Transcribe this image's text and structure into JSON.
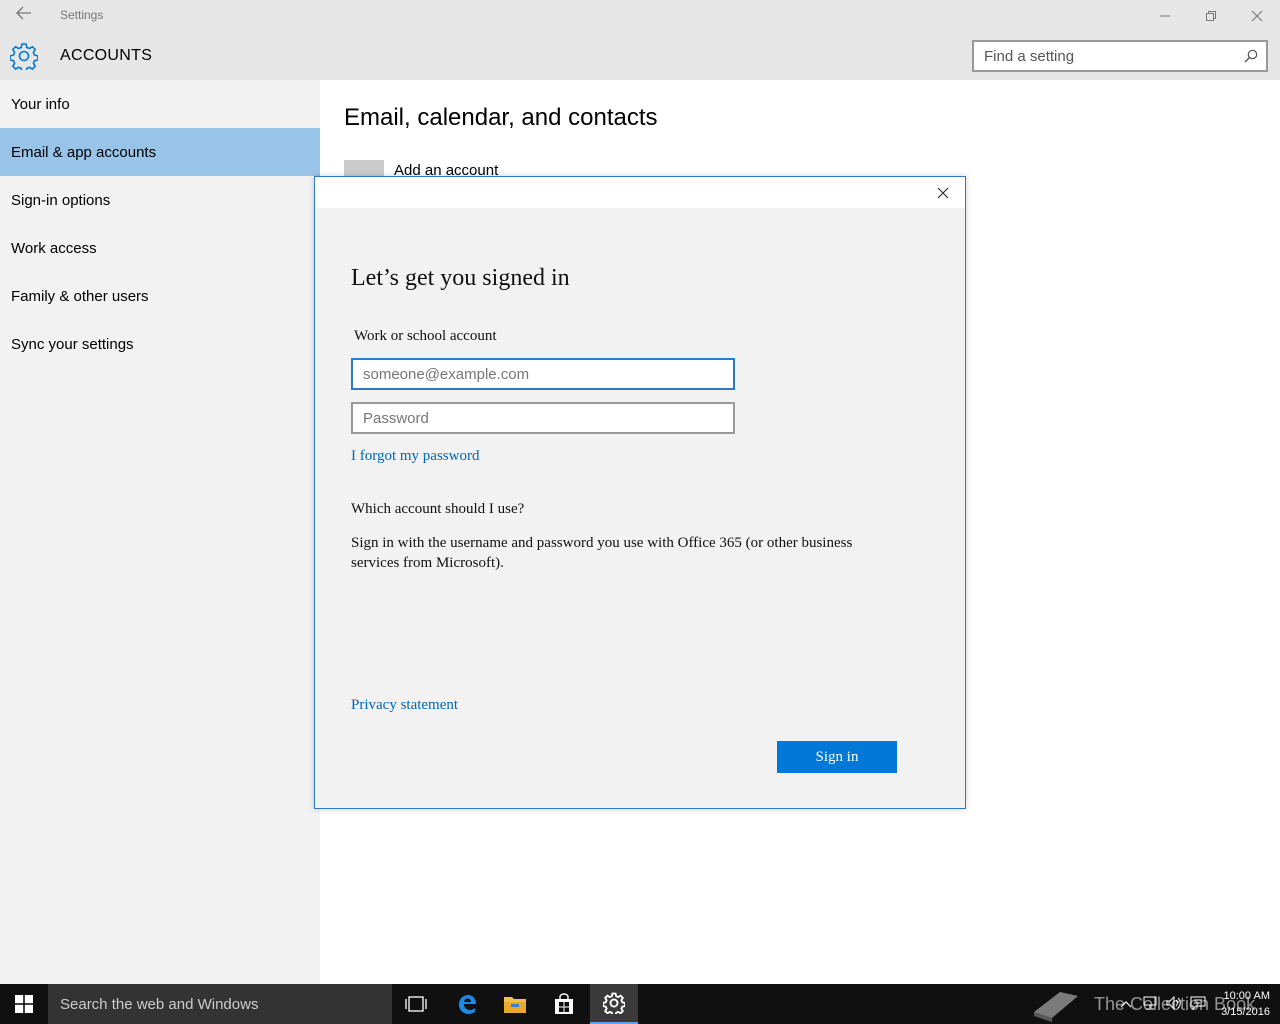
{
  "window": {
    "title": "Settings",
    "back_icon": "back-arrow-icon",
    "controls": [
      "minimize-icon",
      "restore-icon",
      "close-icon"
    ]
  },
  "header": {
    "icon": "gear-icon",
    "section_title": "ACCOUNTS",
    "search_placeholder": "Find a setting",
    "search_icon": "search-icon"
  },
  "sidebar": {
    "items": [
      {
        "label": "Your info",
        "active": false
      },
      {
        "label": "Email & app accounts",
        "active": true
      },
      {
        "label": "Sign-in options",
        "active": false
      },
      {
        "label": "Work access",
        "active": false
      },
      {
        "label": "Family & other users",
        "active": false
      },
      {
        "label": "Sync your settings",
        "active": false
      }
    ]
  },
  "main": {
    "heading": "Email, calendar, and contacts",
    "add_account_label": "Add an account"
  },
  "dialog": {
    "title": "Let’s get you signed in",
    "account_label": "Work or school account",
    "email_placeholder": "someone@example.com",
    "password_placeholder": "Password",
    "forgot_link": "I forgot my password",
    "which_heading": "Which account should I use?",
    "which_body": "Sign in with the username and password you use with Office 365 (or other business services from Microsoft).",
    "privacy_link": "Privacy statement",
    "signin_button": "Sign in",
    "close_icon": "close-icon"
  },
  "taskbar": {
    "search_placeholder": "Search the web and Windows",
    "icons": [
      "windows-start-icon",
      "task-view-icon",
      "edge-icon",
      "file-explorer-icon",
      "store-icon",
      "settings-gear-icon"
    ],
    "watermark_text": "The Collection Book",
    "clock_time": "10:00 AM",
    "clock_date": "3/15/2016"
  },
  "colors": {
    "accent": "#0078d7",
    "sidebar_active": "#99c4e9",
    "link": "#0067b8",
    "chrome": "#e6e6e6"
  }
}
